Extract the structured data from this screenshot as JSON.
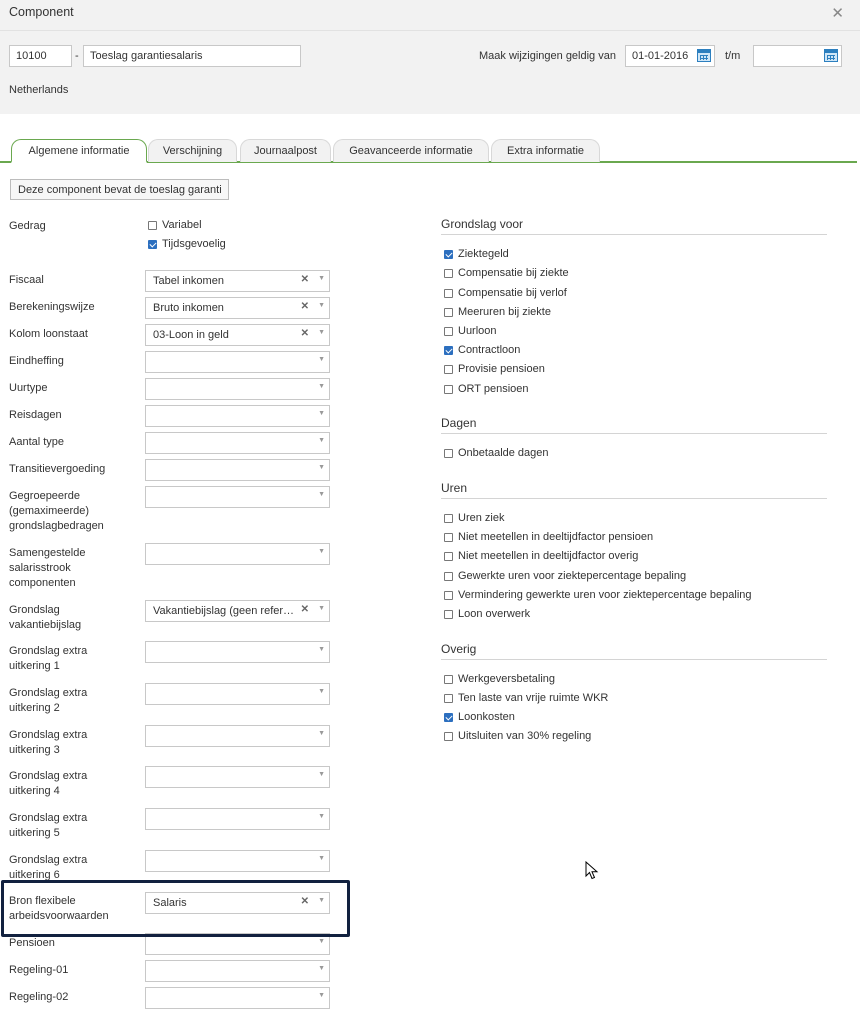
{
  "dialog": {
    "title": "Component"
  },
  "header": {
    "code": "10100",
    "name": "Toeslag garantiesalaris",
    "valid_from_label": "Maak wijzigingen geldig van",
    "valid_from": "01-01-2016",
    "to_label": "t/m",
    "valid_to": "",
    "country": "Netherlands"
  },
  "tabs": [
    "Algemene informatie",
    "Verschijning",
    "Journaalpost",
    "Geavanceerde informatie",
    "Extra informatie"
  ],
  "action_button": "Deze component bevat de toeslag garanti",
  "gedrag": {
    "label": "Gedrag",
    "options": [
      {
        "label": "Variabel",
        "checked": false
      },
      {
        "label": "Tijdsgevoelig",
        "checked": true
      }
    ]
  },
  "fields": [
    {
      "label": "Fiscaal",
      "value": "Tabel inkomen",
      "clearable": true
    },
    {
      "label": "Berekeningswijze",
      "value": "Bruto inkomen",
      "clearable": true
    },
    {
      "label": "Kolom loonstaat",
      "value": "03-Loon in geld",
      "clearable": true
    },
    {
      "label": "Eindheffing",
      "value": "",
      "clearable": false
    },
    {
      "label": "Uurtype",
      "value": "",
      "clearable": false
    },
    {
      "label": "Reisdagen",
      "value": "",
      "clearable": false
    },
    {
      "label": "Aantal type",
      "value": "",
      "clearable": false
    },
    {
      "label": "Transitievergoeding",
      "value": "",
      "clearable": false
    },
    {
      "label": "Gegroepeerde (gemaximeerde) grondslagbedragen",
      "value": "",
      "clearable": false
    },
    {
      "label": "Samengestelde salarisstrook componenten",
      "value": "",
      "clearable": false
    },
    {
      "label": "Grondslag vakantiebijslag",
      "value": "Vakantiebijslag (geen refer…",
      "clearable": true
    },
    {
      "label": "Grondslag extra uitkering 1",
      "value": "",
      "clearable": false
    },
    {
      "label": "Grondslag extra uitkering 2",
      "value": "",
      "clearable": false
    },
    {
      "label": "Grondslag extra uitkering 3",
      "value": "",
      "clearable": false
    },
    {
      "label": "Grondslag extra uitkering 4",
      "value": "",
      "clearable": false
    },
    {
      "label": "Grondslag extra uitkering 5",
      "value": "",
      "clearable": false
    },
    {
      "label": "Grondslag extra uitkering 6",
      "value": "",
      "clearable": false
    },
    {
      "label": "Bron flexibele arbeidsvoorwaarden",
      "value": "Salaris",
      "clearable": true
    },
    {
      "label": "Pensioen",
      "value": "",
      "clearable": false
    },
    {
      "label": "Regeling-01",
      "value": "",
      "clearable": false
    },
    {
      "label": "Regeling-02",
      "value": "",
      "clearable": false
    }
  ],
  "right_sections": [
    {
      "title": "Grondslag voor",
      "items": [
        {
          "label": "Ziektegeld",
          "checked": true
        },
        {
          "label": "Compensatie bij ziekte",
          "checked": false
        },
        {
          "label": "Compensatie bij verlof",
          "checked": false
        },
        {
          "label": "Meeruren bij ziekte",
          "checked": false
        },
        {
          "label": "Uurloon",
          "checked": false
        },
        {
          "label": "Contractloon",
          "checked": true
        },
        {
          "label": "Provisie pensioen",
          "checked": false
        },
        {
          "label": "ORT pensioen",
          "checked": false
        }
      ]
    },
    {
      "title": "Dagen",
      "items": [
        {
          "label": "Onbetaalde dagen",
          "checked": false
        }
      ]
    },
    {
      "title": "Uren",
      "items": [
        {
          "label": "Uren ziek",
          "checked": false
        },
        {
          "label": "Niet meetellen in deeltijdfactor pensioen",
          "checked": false
        },
        {
          "label": "Niet meetellen in deeltijdfactor overig",
          "checked": false
        },
        {
          "label": "Gewerkte uren voor ziektepercentage bepaling",
          "checked": false
        },
        {
          "label": "Vermindering gewerkte uren voor ziektepercentage bepaling",
          "checked": false
        },
        {
          "label": "Loon overwerk",
          "checked": false
        }
      ]
    },
    {
      "title": "Overig",
      "items": [
        {
          "label": "Werkgeversbetaling",
          "checked": false
        },
        {
          "label": "Ten laste van vrije ruimte WKR",
          "checked": false
        },
        {
          "label": "Loonkosten",
          "checked": true
        },
        {
          "label": "Uitsluiten van 30% regeling",
          "checked": false
        }
      ]
    }
  ],
  "colors": {
    "accent_green": "#6aa84f",
    "checkbox_blue": "#2c6fbf",
    "highlight_navy": "#12213f"
  }
}
